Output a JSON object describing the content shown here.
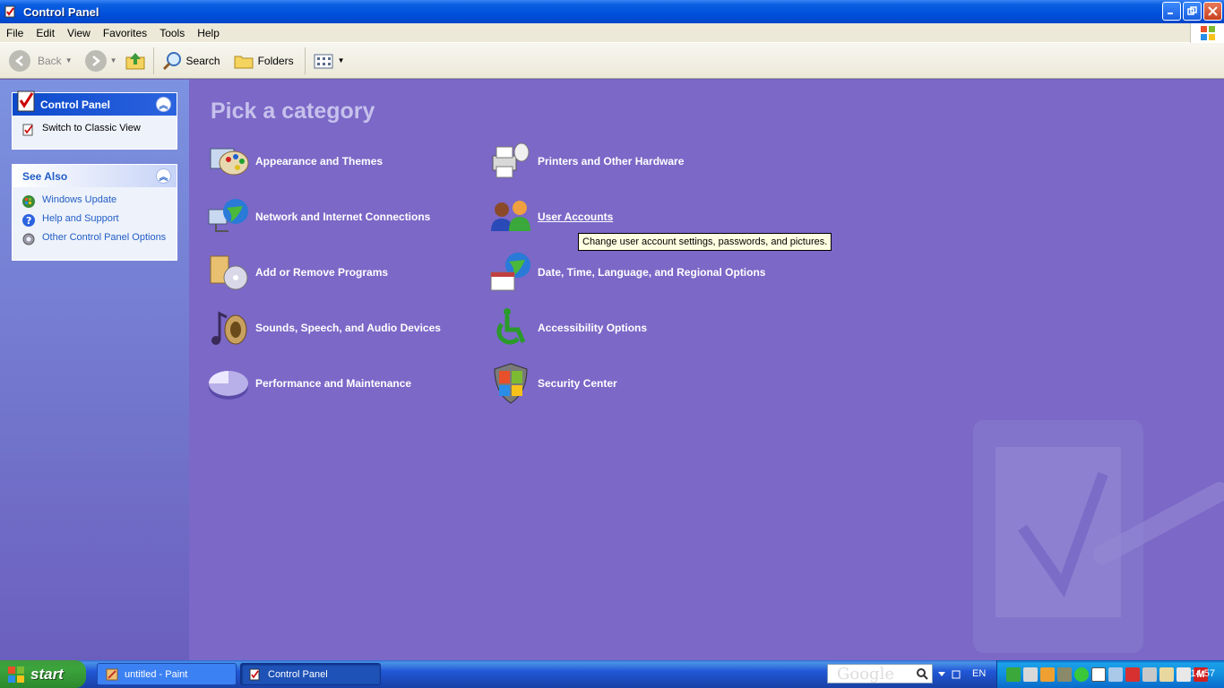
{
  "window": {
    "title": "Control Panel"
  },
  "menu": [
    "File",
    "Edit",
    "View",
    "Favorites",
    "Tools",
    "Help"
  ],
  "toolbar": {
    "back": "Back",
    "search": "Search",
    "folders": "Folders"
  },
  "sidebar": {
    "control_panel_box": {
      "title": "Control Panel",
      "links": [
        "Switch to Classic View"
      ]
    },
    "see_also_box": {
      "title": "See Also",
      "links": [
        "Windows Update",
        "Help and Support",
        "Other Control Panel Options"
      ]
    }
  },
  "main": {
    "heading": "Pick a category",
    "categories_left": [
      "Appearance and Themes",
      "Network and Internet Connections",
      "Add or Remove Programs",
      "Sounds, Speech, and Audio Devices",
      "Performance and Maintenance"
    ],
    "categories_right": [
      "Printers and Other Hardware",
      "User Accounts",
      "Date, Time, Language, and Regional Options",
      "Accessibility Options",
      "Security Center"
    ],
    "tooltip": "Change user account settings, passwords, and pictures."
  },
  "taskbar": {
    "start": "start",
    "tasks": [
      "untitled - Paint",
      "Control Panel"
    ],
    "search_logo": "Google",
    "language": "EN",
    "clock": "14:57"
  },
  "colors": {
    "titlebar": "#0050dc",
    "main_bg": "#7b68c7",
    "sidebar_link": "#215dc6",
    "start_green": "#3ca43c"
  }
}
